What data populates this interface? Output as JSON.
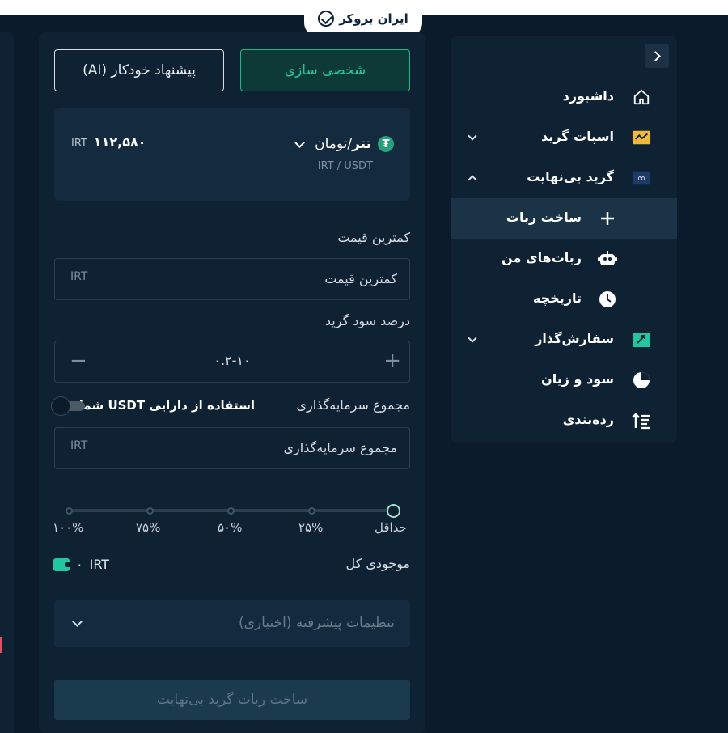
{
  "brand": {
    "name": "ایران بروکر"
  },
  "tabs": {
    "custom_label": "شخصی سازی",
    "ai_label": "پیشنهاد خودکار (AI)"
  },
  "pair": {
    "coin": "تتر",
    "quote": "/تومان",
    "symbol": "IRT / USDT",
    "price": "۱۱۲,۵۸۰",
    "price_unit": "IRT"
  },
  "form": {
    "min_price": {
      "label": "کمترین قیمت",
      "placeholder": "کمترین قیمت",
      "unit": "IRT"
    },
    "grid_profit": {
      "label": "درصد سود گرید",
      "value": "۰.۲-۱۰",
      "minus": "−",
      "plus": "+"
    },
    "investment": {
      "label": "مجموع سرمایه‌گذاری",
      "use_usdt_label": "استفاده از دارایی USDT شما",
      "use_usdt_on": false,
      "placeholder": "مجموع سرمایه‌گذاری",
      "unit": "IRT"
    },
    "slider": {
      "ticks": [
        "حداقل",
        "۲۵%",
        "۵۰%",
        "۷۵%",
        "۱۰۰%"
      ],
      "selected": "حداقل"
    },
    "balance": {
      "label": "موجودی کل",
      "value": "۰",
      "unit": "IRT"
    },
    "advanced_label": "تنظیمات پیشرفته (اختیاری)",
    "submit_label": "ساخت ربات گرید بی‌نهایت"
  },
  "sidebar": {
    "items": [
      {
        "label": "داشبورد",
        "icon": "home-icon"
      },
      {
        "label": "اسپات گرید",
        "icon": "spot-grid-icon",
        "caret": "down"
      },
      {
        "label": "گرید بی‌نهایت",
        "icon": "infinity-icon",
        "caret": "up"
      },
      {
        "label": "ساخت ربات",
        "icon": "plus-icon",
        "active": true
      },
      {
        "label": "ربات‌های من",
        "icon": "robot-icon"
      },
      {
        "label": "تاریخچه",
        "icon": "clock-icon"
      },
      {
        "label": "سفارش‌گذار",
        "icon": "order-icon",
        "caret": "down"
      },
      {
        "label": "سود و زیان",
        "icon": "pie-chart-icon"
      },
      {
        "label": "رده‌بندی",
        "icon": "ranking-icon"
      }
    ]
  },
  "colors": {
    "accent": "#22c7a0",
    "background": "#0b1b2b",
    "panel": "#0f2233"
  }
}
